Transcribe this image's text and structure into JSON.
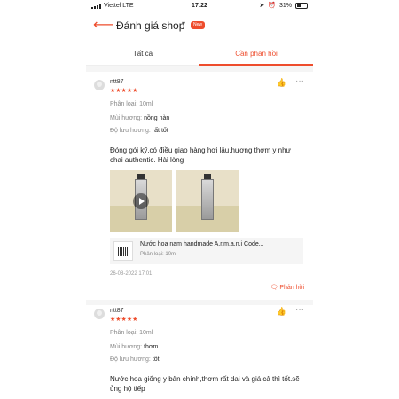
{
  "status_bar": {
    "carrier": "Viettel  LTE",
    "time": "17:22",
    "battery_percent": "31%",
    "battery_level": 0.31
  },
  "header": {
    "title": "Đánh giá shop",
    "badge": "New",
    "back_icon": "back-arrow-icon"
  },
  "tabs": [
    {
      "label": "Tất cả",
      "active": false
    },
    {
      "label": "Cần phản hồi",
      "active": true
    }
  ],
  "reviews": [
    {
      "username": "ntt87",
      "rating": 5,
      "stars": "★★★★★",
      "variant": "Phân loại: 10ml",
      "scent_label": "Mùi hương:",
      "scent_value": "nồng nàn",
      "longevity_label": "Độ lưu hương:",
      "longevity_value": "rất tốt",
      "text": "Đóng gói kỹ,có điều giao hàng hơi lâu.hương thơm y như chai authentic. Hài lòng",
      "product_name": "Nước hoa nam handmade A.r.m.a.n.i Code...",
      "product_variant": "Phân loại: 10ml",
      "date": "26-08-2022 17:01",
      "reply_label": "Phản hồi"
    },
    {
      "username": "ntt87",
      "rating": 5,
      "stars": "★★★★★",
      "variant": "Phân loại: 10ml",
      "scent_label": "Mùi hương:",
      "scent_value": "thơm",
      "longevity_label": "Độ lưu hương:",
      "longevity_value": "tốt",
      "text": "Nước hoa giống y bản chính,thơm rất dai và giá cả thì tốt.sẽ ủng hộ tiếp"
    }
  ],
  "colors": {
    "accent": "#ee4d2d",
    "separator": "#f5f5f5"
  }
}
